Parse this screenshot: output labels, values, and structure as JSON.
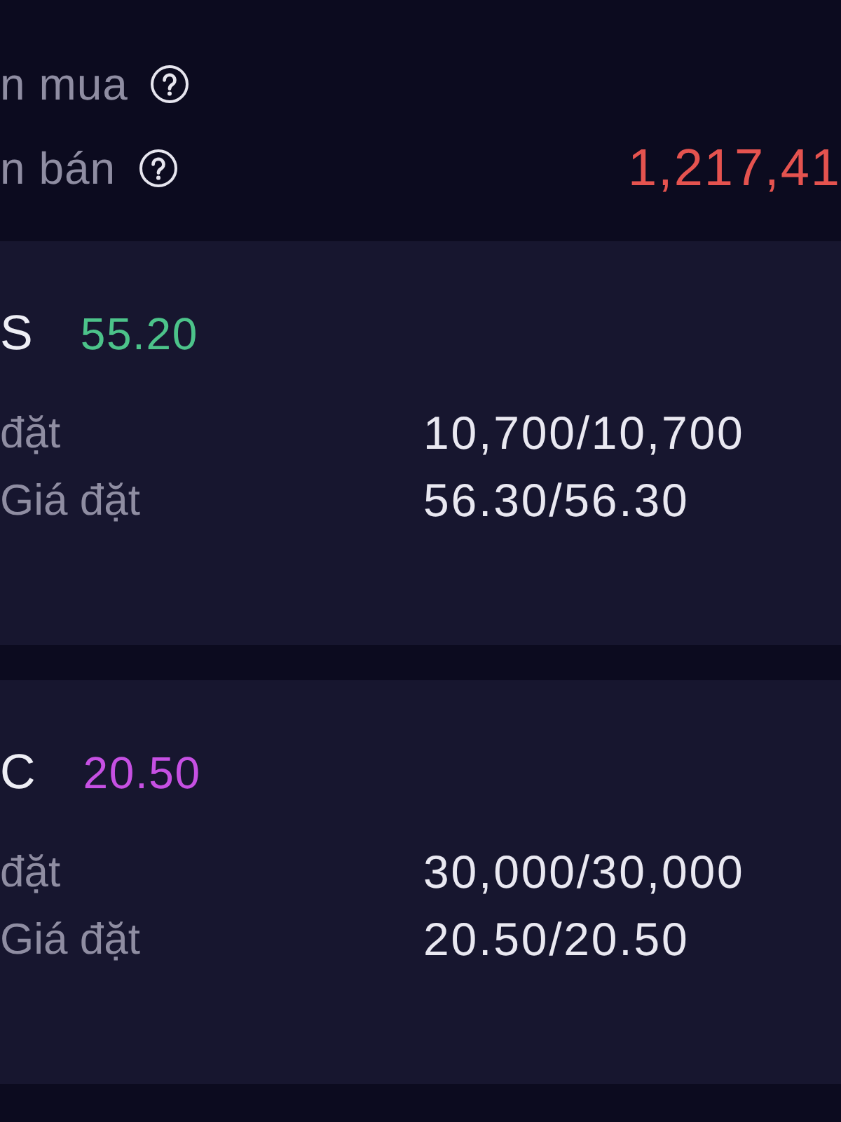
{
  "summary": {
    "rows": [
      {
        "label": "n mua",
        "help": true
      },
      {
        "label": "n bán",
        "help": true,
        "value": "1,217,41"
      }
    ]
  },
  "orders": [
    {
      "symbol": "S",
      "price": "55.20",
      "color": "#4cc38a",
      "fields": [
        {
          "label": "đặt",
          "value": "10,700/10,700"
        },
        {
          "label": "Giá đặt",
          "value": "56.30/56.30"
        }
      ]
    },
    {
      "symbol": "C",
      "price": "20.50",
      "color": "#c650e3",
      "fields": [
        {
          "label": "đặt",
          "value": "30,000/30,000"
        },
        {
          "label": "Giá đặt",
          "value": "20.50/20.50"
        }
      ]
    }
  ]
}
